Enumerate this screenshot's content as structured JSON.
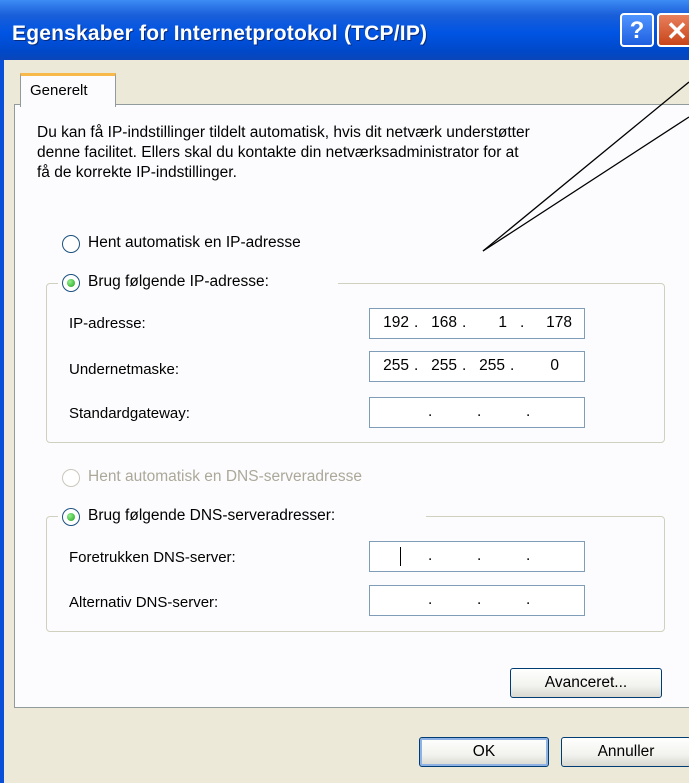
{
  "window": {
    "title": "Egenskaber for Internetprotokol (TCP/IP)",
    "help_label": "?",
    "close_label": "✕"
  },
  "tabs": [
    {
      "label": "Generelt"
    }
  ],
  "description": [
    "Du kan få IP-indstillinger tildelt automatisk, hvis dit netværk understøtter",
    "denne facilitet. Ellers skal du kontakte din netværksadministrator for at",
    "få de korrekte IP-indstillinger."
  ],
  "ip_section": {
    "auto_label": "Hent automatisk en IP-adresse",
    "manual_label": "Brug følgende IP-adresse:",
    "selected": "manual",
    "fields": [
      {
        "label": "IP-adresse:",
        "octets": [
          "192",
          "168",
          "1",
          "178"
        ]
      },
      {
        "label": "Undernetmaske:",
        "octets": [
          "255",
          "255",
          "255",
          "0"
        ]
      },
      {
        "label": "Standardgateway:",
        "octets": [
          "",
          "",
          "",
          ""
        ]
      }
    ]
  },
  "dns_section": {
    "auto_label": "Hent automatisk en DNS-serveradresse",
    "manual_label": "Brug følgende DNS-serveradresser:",
    "selected": "manual",
    "fields": [
      {
        "label": "Foretrukken DNS-server:",
        "octets": [
          "",
          "",
          "",
          ""
        ]
      },
      {
        "label": "Alternativ DNS-server:",
        "octets": [
          "",
          "",
          "",
          ""
        ]
      }
    ]
  },
  "buttons": {
    "advanced": "Avanceret...",
    "ok": "OK",
    "cancel": "Annuller"
  },
  "colors": {
    "title_bar": "#0054e3",
    "dialog_bg": "#ece9d8",
    "panel_bg": "#fcfcfe",
    "radio_dot": "#21a121"
  }
}
